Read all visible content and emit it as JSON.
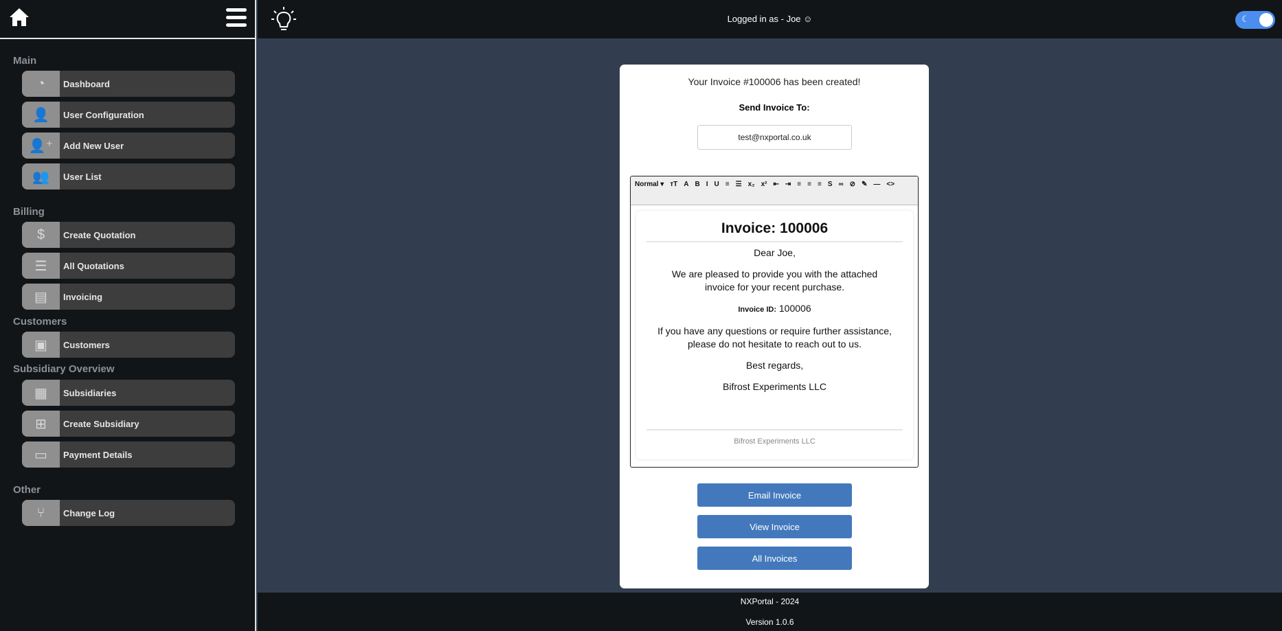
{
  "header": {
    "logged_in": "Logged in as - Joe"
  },
  "sidebar": {
    "sections": [
      {
        "label": "Main",
        "items": [
          {
            "label": "Dashboard",
            "icon": "gauge-icon"
          },
          {
            "label": "User Configuration",
            "icon": "user-icon"
          },
          {
            "label": "Add New User",
            "icon": "user-plus-icon"
          },
          {
            "label": "User List",
            "icon": "users-icon"
          }
        ]
      },
      {
        "label": "Billing",
        "items": [
          {
            "label": "Create Quotation",
            "icon": "file-dollar-icon"
          },
          {
            "label": "All Quotations",
            "icon": "file-lines-icon"
          },
          {
            "label": "Invoicing",
            "icon": "file-invoice-icon"
          }
        ]
      },
      {
        "label": "Customers",
        "items": [
          {
            "label": "Customers",
            "icon": "address-book-icon"
          }
        ]
      },
      {
        "label": "Subsidiary Overview",
        "items": [
          {
            "label": "Subsidiaries",
            "icon": "building-icon"
          },
          {
            "label": "Create Subsidiary",
            "icon": "plus-square-icon"
          },
          {
            "label": "Payment Details",
            "icon": "credit-card-icon"
          }
        ]
      },
      {
        "label": "Other",
        "items": [
          {
            "label": "Change Log",
            "icon": "code-branch-icon"
          }
        ]
      }
    ]
  },
  "card": {
    "title": "Your Invoice #100006 has been created!",
    "send_to": "Send Invoice To:",
    "email": "test@nxportal.co.uk"
  },
  "toolbar": [
    "Normal ▾",
    "тT",
    "A",
    "B",
    "I",
    "U",
    "≡",
    "☰",
    "x₂",
    "x²",
    "⇤",
    "⇥",
    "≡",
    "≡",
    "≡",
    "S",
    "∞",
    "⊘",
    "✎",
    "—",
    "<>"
  ],
  "mail": {
    "heading": "Invoice: 100006",
    "greeting": "Dear Joe,",
    "body1": "We are pleased to provide you with the attached invoice for your recent purchase.",
    "id_label": "Invoice ID:",
    "id_value": "100006",
    "body2": "If you have any questions or require further assistance, please do not hesitate to reach out to us.",
    "regards": "Best regards,",
    "company": "Bifrost Experiments LLC",
    "footer": "Bifrost Experiments LLC"
  },
  "buttons": {
    "email": "Email Invoice",
    "view": "View Invoice",
    "all": "All Invoices"
  },
  "footer": {
    "line1": "NXPortal - 2024",
    "line2": "Version 1.0.6"
  },
  "colors": {
    "accent": "#4379bc",
    "toggle": "#4b8ef0"
  }
}
